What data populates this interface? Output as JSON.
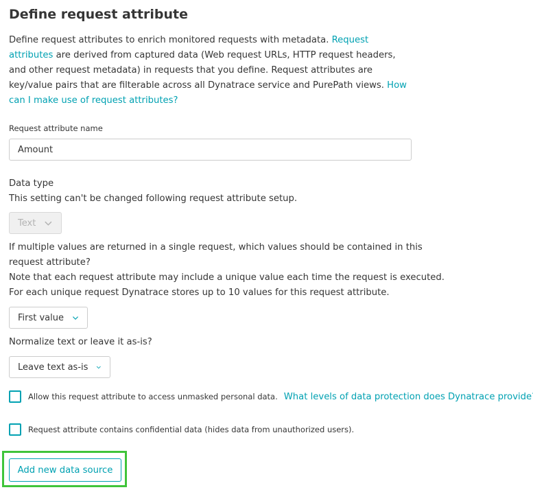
{
  "header": {
    "title": "Define request attribute"
  },
  "intro": {
    "text_1": "Define request attributes to enrich monitored requests with metadata. ",
    "link_1": "Request attributes",
    "text_2": " are derived from captured data (Web request URLs, HTTP request headers, and other request metadata) in requests that you define. Request attributes are key/value pairs that are filterable across all Dynatrace service and PurePath views. ",
    "link_2": "How can I make use of request attributes?"
  },
  "name_field": {
    "label": "Request attribute name",
    "value": "Amount"
  },
  "data_type": {
    "label": "Data type",
    "note": "This setting can't be changed following request attribute setup.",
    "selected": "Text"
  },
  "multiple_values": {
    "line_1": "If multiple values are returned in a single request, which values should be contained in this request attribute?",
    "line_2": "Note that each request attribute may include a unique value each time the request is executed.",
    "line_3": "For each unique request Dynatrace stores up to 10 values for this request attribute.",
    "selected": "First value"
  },
  "normalize": {
    "label": "Normalize text or leave it as-is?",
    "selected": "Leave text as-is"
  },
  "checkboxes": {
    "personal_data_label": "Allow this request attribute to access unmasked personal data.",
    "personal_data_link": "What levels of data protection does Dynatrace provide?",
    "confidential_label": "Request attribute contains confidential data (hides data from unauthorized users)."
  },
  "actions": {
    "add_data_source": "Add new data source"
  },
  "colors": {
    "accent": "#00a1b2",
    "highlight": "#3fc43a",
    "text": "#353535"
  }
}
